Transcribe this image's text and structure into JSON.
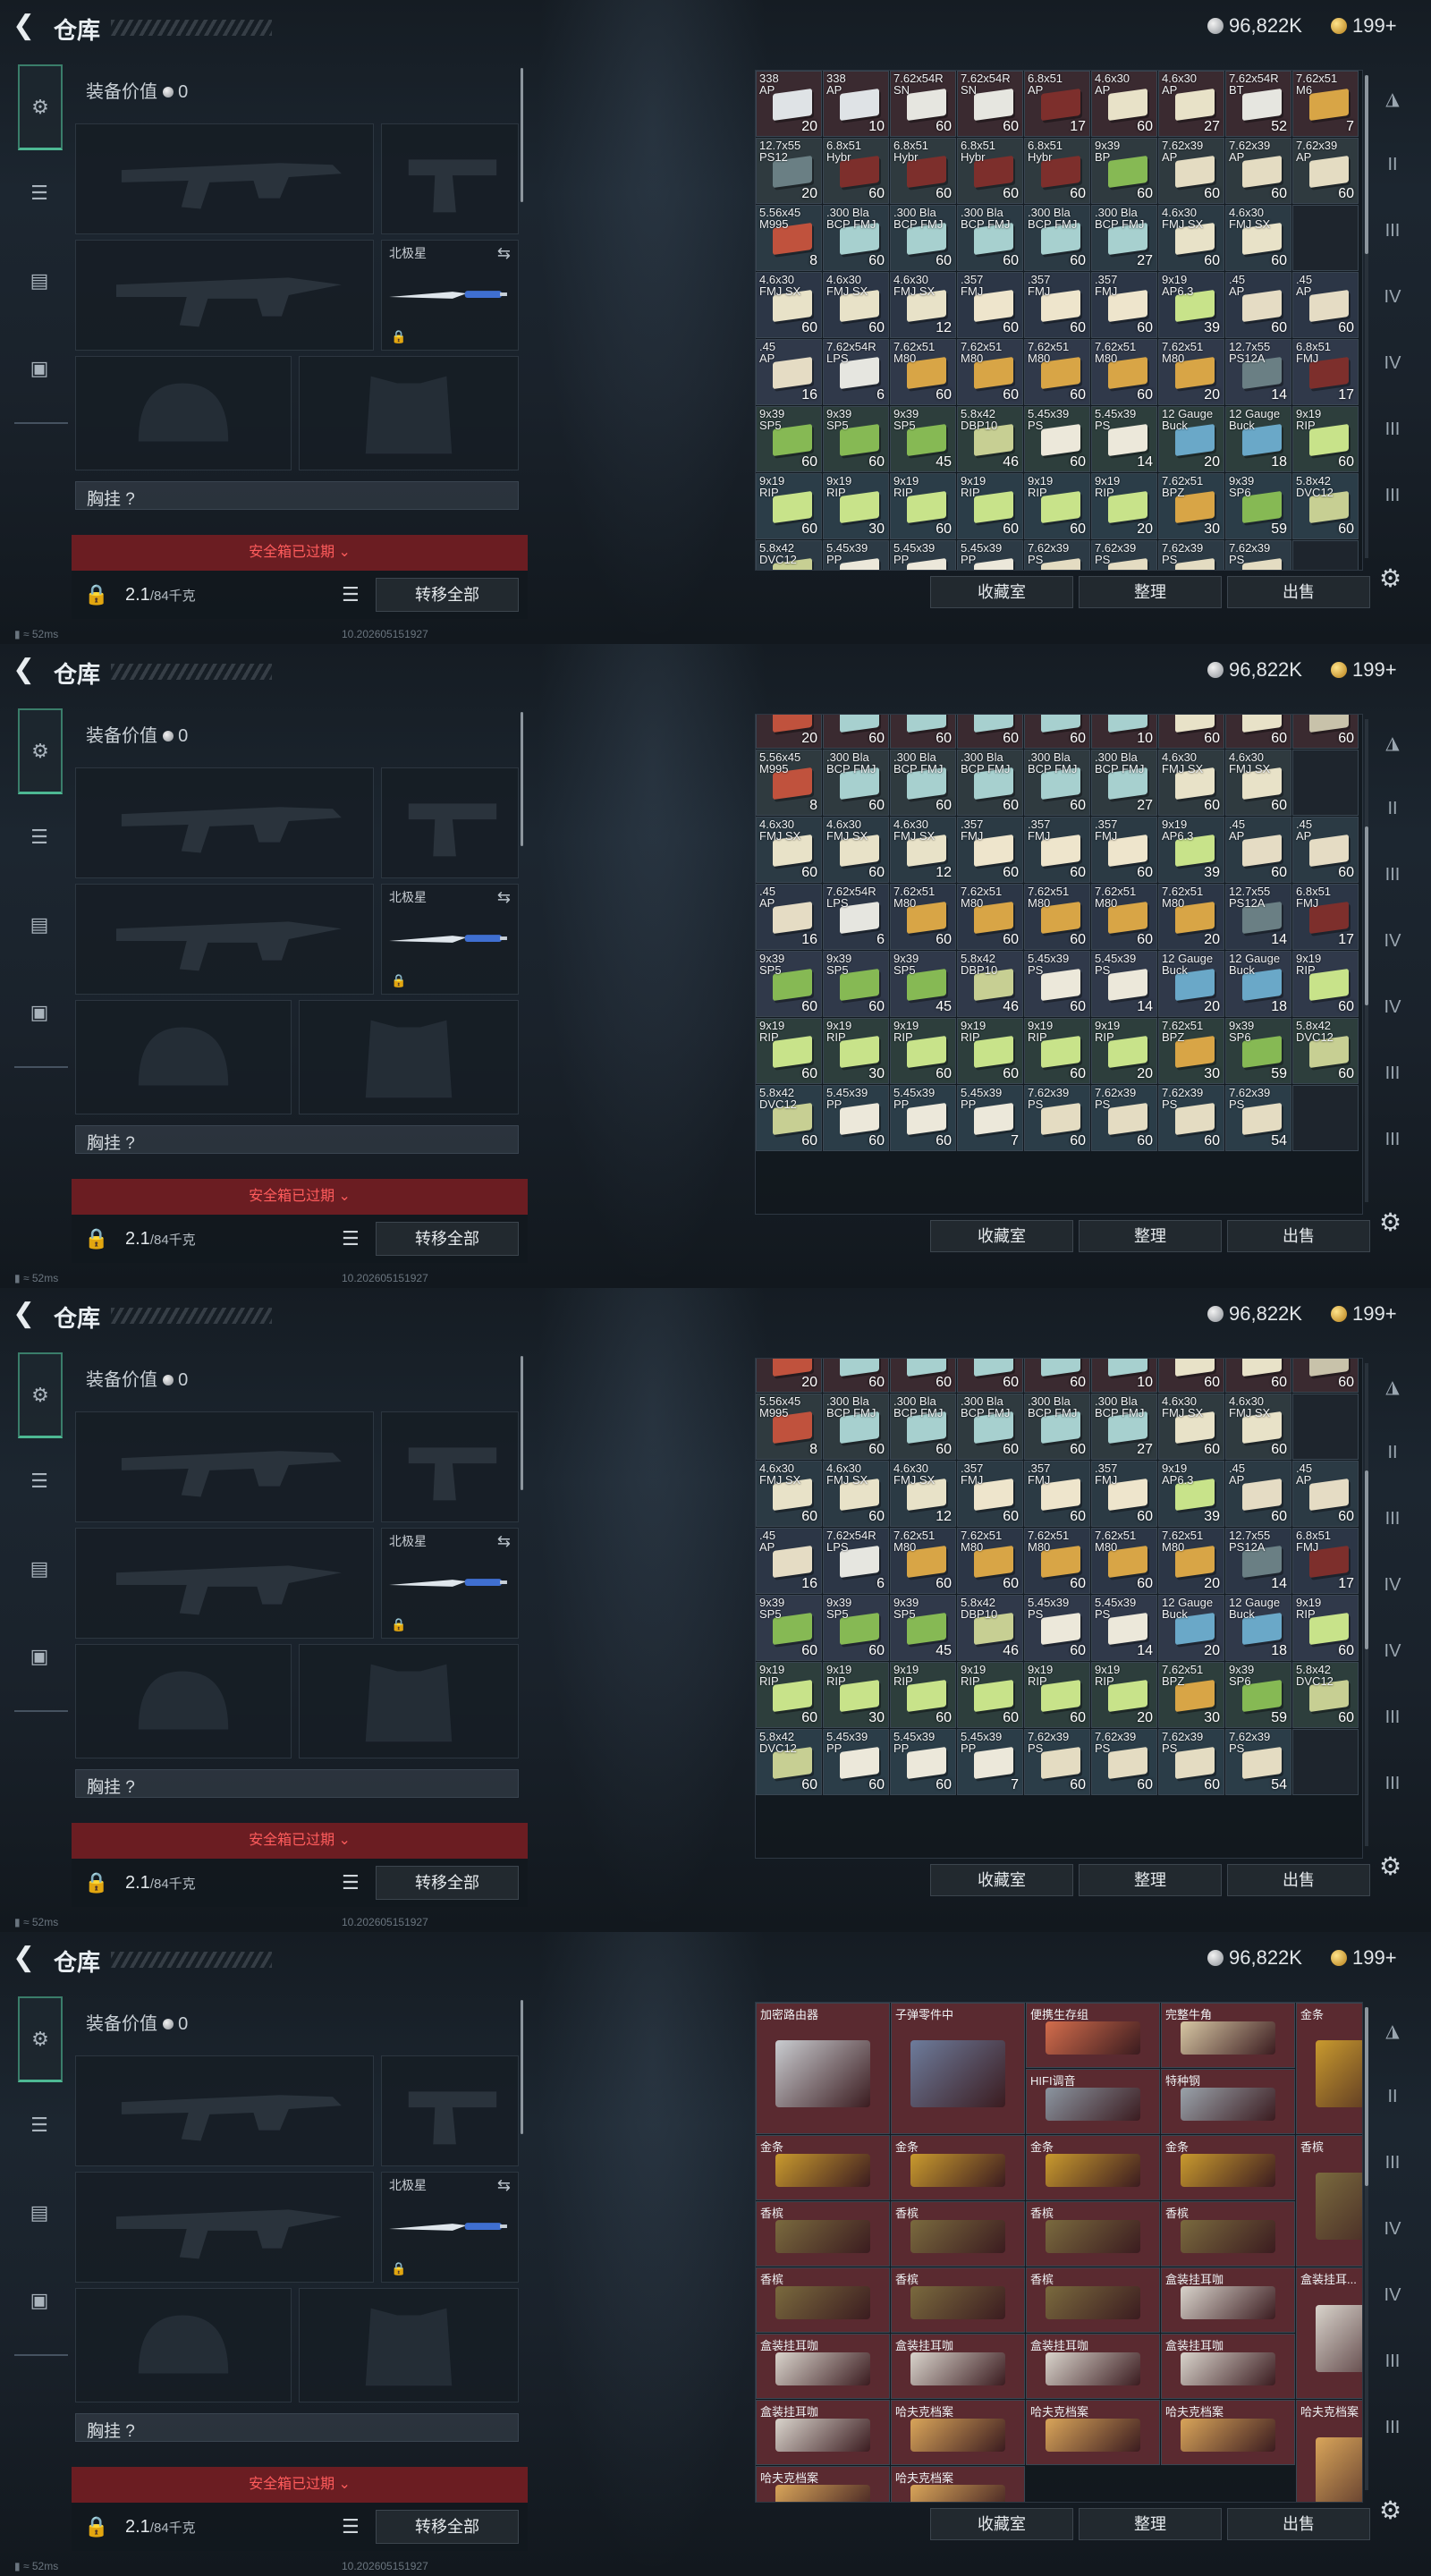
{
  "header": {
    "title": "仓库",
    "back_icon": "back-arrow-icon",
    "silver": "96,822K",
    "gold": "199+"
  },
  "left": {
    "equip_value_label": "装备价值",
    "equip_value": "0",
    "knife_name": "北极星",
    "vest_label": "胸挂",
    "vest_value": "?",
    "safe_box": "安全箱已过期",
    "weight": "2.1",
    "weight_cap": "/84千克",
    "transfer_all": "转移全部"
  },
  "right_buttons": {
    "collection": "收藏室",
    "sort": "整理",
    "sell": "出售"
  },
  "footer": {
    "ping": "52ms",
    "build": "10.2026051519​27"
  },
  "colors": {
    "accent": "#4db893",
    "danger": "#ff5c5c",
    "safe_bg": "#6b1d22"
  },
  "frames": [
    {
      "rows": [
        [
          [
            "338\nAP",
            "20"
          ],
          [
            "338\nAP",
            "10"
          ],
          [
            "7.62x54R\nSN",
            "60"
          ],
          [
            "7.62x54R\nSN",
            "60"
          ],
          [
            "6.8x51\nAP",
            "17"
          ],
          [
            "4.6x30\nAP",
            "60"
          ],
          [
            "4.6x30\nAP",
            "27"
          ],
          [
            "7.62x54R\nBT",
            "52"
          ],
          [
            "7.62x51\nM6",
            "7"
          ]
        ],
        [
          [
            "12.7x55\nPS12",
            "20"
          ],
          [
            "6.8x51\nHybr",
            "60"
          ],
          [
            "6.8x51\nHybr",
            "60"
          ],
          [
            "6.8x51\nHybr",
            "60"
          ],
          [
            "6.8x51\nHybr",
            "60"
          ],
          [
            "9x39\nBP",
            "60"
          ],
          [
            "7.62x39\nAP",
            "60"
          ],
          [
            "7.62x39\nAP",
            "60"
          ],
          [
            "7.62x39\nAP",
            "60"
          ]
        ],
        [
          [
            "5.56x45\nM995",
            "8"
          ],
          [
            ".300 Bla\nBCP FMJ",
            "60"
          ],
          [
            ".300 Bla\nBCP FMJ",
            "60"
          ],
          [
            ".300 Bla\nBCP FMJ",
            "60"
          ],
          [
            ".300 Bla\nBCP FMJ",
            "60"
          ],
          [
            ".300 Bla\nBCP FMJ",
            "27"
          ],
          [
            "4.6x30\nFMJ SX",
            "60"
          ],
          [
            "4.6x30\nFMJ SX",
            "60"
          ]
        ],
        [
          [
            "4.6x30\nFMJ SX",
            "60"
          ],
          [
            "4.6x30\nFMJ SX",
            "60"
          ],
          [
            "4.6x30\nFMJ SX",
            "12"
          ],
          [
            ".357\nFMJ",
            "60"
          ],
          [
            ".357\nFMJ",
            "60"
          ],
          [
            ".357\nFMJ",
            "60"
          ],
          [
            "9x19\nAP6.3",
            "39"
          ],
          [
            ".45\nAP",
            "60"
          ],
          [
            ".45\nAP",
            "60"
          ]
        ],
        [
          [
            ".45\nAP",
            "16"
          ],
          [
            "7.62x54R\nLPS",
            "6"
          ],
          [
            "7.62x51\nM80",
            "60"
          ],
          [
            "7.62x51\nM80",
            "60"
          ],
          [
            "7.62x51\nM80",
            "60"
          ],
          [
            "7.62x51\nM80",
            "60"
          ],
          [
            "7.62x51\nM80",
            "20"
          ],
          [
            "12.7x55\nPS12A",
            "14"
          ],
          [
            "6.8x51\nFMJ",
            "17"
          ]
        ],
        [
          [
            "9x39\nSP5",
            "60"
          ],
          [
            "9x39\nSP5",
            "60"
          ],
          [
            "9x39\nSP5",
            "45"
          ],
          [
            "5.8x42\nDBP10",
            "46"
          ],
          [
            "5.45x39\nPS",
            "60"
          ],
          [
            "5.45x39\nPS",
            "14"
          ],
          [
            "12 Gauge\nBuck",
            "20"
          ],
          [
            "12 Gauge\nBuck",
            "18"
          ],
          [
            "9x19\nRIP",
            "60"
          ]
        ],
        [
          [
            "9x19\nRIP",
            "60"
          ],
          [
            "9x19\nRIP",
            "30"
          ],
          [
            "9x19\nRIP",
            "60"
          ],
          [
            "9x19\nRIP",
            "60"
          ],
          [
            "9x19\nRIP",
            "60"
          ],
          [
            "9x19\nRIP",
            "20"
          ],
          [
            "7.62x51\nBPZ",
            "30"
          ],
          [
            "9x39\nSP6",
            "59"
          ],
          [
            "5.8x42\nDVC12",
            "60"
          ]
        ],
        [
          [
            "5.8x42\nDVC12",
            ""
          ],
          [
            "5.45x39\nPP",
            ""
          ],
          [
            "5.45x39\nPP",
            ""
          ],
          [
            "5.45x39\nPP",
            ""
          ],
          [
            "7.62x39\nPS",
            ""
          ],
          [
            "7.62x39\nPS",
            ""
          ],
          [
            "7.62x39\nPS",
            ""
          ],
          [
            "7.62x39\nPS",
            ""
          ]
        ]
      ]
    },
    {
      "rows": [
        [
          [
            "",
            "20"
          ],
          [
            "",
            "60"
          ],
          [
            "",
            "60"
          ],
          [
            "",
            "60"
          ],
          [
            "",
            "60"
          ],
          [
            "",
            "10"
          ],
          [
            "",
            "60"
          ],
          [
            "",
            "60"
          ],
          [
            "",
            "60"
          ]
        ],
        [
          [
            "5.56x45\nM995",
            "8"
          ],
          [
            ".300 Bla\nBCP FMJ",
            "60"
          ],
          [
            ".300 Bla\nBCP FMJ",
            "60"
          ],
          [
            ".300 Bla\nBCP FMJ",
            "60"
          ],
          [
            ".300 Bla\nBCP FMJ",
            "60"
          ],
          [
            ".300 Bla\nBCP FMJ",
            "27"
          ],
          [
            "4.6x30\nFMJ SX",
            "60"
          ],
          [
            "4.6x30\nFMJ SX",
            "60"
          ]
        ],
        [
          [
            "4.6x30\nFMJ SX",
            "60"
          ],
          [
            "4.6x30\nFMJ SX",
            "60"
          ],
          [
            "4.6x30\nFMJ SX",
            "12"
          ],
          [
            ".357\nFMJ",
            "60"
          ],
          [
            ".357\nFMJ",
            "60"
          ],
          [
            ".357\nFMJ",
            "60"
          ],
          [
            "9x19\nAP6.3",
            "39"
          ],
          [
            ".45\nAP",
            "60"
          ],
          [
            ".45\nAP",
            "60"
          ]
        ],
        [
          [
            ".45\nAP",
            "16"
          ],
          [
            "7.62x54R\nLPS",
            "6"
          ],
          [
            "7.62x51\nM80",
            "60"
          ],
          [
            "7.62x51\nM80",
            "60"
          ],
          [
            "7.62x51\nM80",
            "60"
          ],
          [
            "7.62x51\nM80",
            "60"
          ],
          [
            "7.62x51\nM80",
            "20"
          ],
          [
            "12.7x55\nPS12A",
            "14"
          ],
          [
            "6.8x51\nFMJ",
            "17"
          ]
        ],
        [
          [
            "9x39\nSP5",
            "60"
          ],
          [
            "9x39\nSP5",
            "60"
          ],
          [
            "9x39\nSP5",
            "45"
          ],
          [
            "5.8x42\nDBP10",
            "46"
          ],
          [
            "5.45x39\nPS",
            "60"
          ],
          [
            "5.45x39\nPS",
            "14"
          ],
          [
            "12 Gauge\nBuck",
            "20"
          ],
          [
            "12 Gauge\nBuck",
            "18"
          ],
          [
            "9x19\nRIP",
            "60"
          ]
        ],
        [
          [
            "9x19\nRIP",
            "60"
          ],
          [
            "9x19\nRIP",
            "30"
          ],
          [
            "9x19\nRIP",
            "60"
          ],
          [
            "9x19\nRIP",
            "60"
          ],
          [
            "9x19\nRIP",
            "60"
          ],
          [
            "9x19\nRIP",
            "20"
          ],
          [
            "7.62x51\nBPZ",
            "30"
          ],
          [
            "9x39\nSP6",
            "59"
          ],
          [
            "5.8x42\nDVC12",
            "60"
          ]
        ],
        [
          [
            "5.8x42\nDVC12",
            "60"
          ],
          [
            "5.45x39\nPP",
            "60"
          ],
          [
            "5.45x39\nPP",
            "60"
          ],
          [
            "5.45x39\nPP",
            "7"
          ],
          [
            "7.62x39\nPS",
            "60"
          ],
          [
            "7.62x39\nPS",
            "60"
          ],
          [
            "7.62x39\nPS",
            "60"
          ],
          [
            "7.62x39\nPS",
            "54"
          ]
        ]
      ]
    },
    {
      "rows": [
        [
          [
            "",
            "20"
          ],
          [
            "",
            "60"
          ],
          [
            "",
            "60"
          ],
          [
            "",
            "60"
          ],
          [
            "",
            "60"
          ],
          [
            "",
            "10"
          ],
          [
            "",
            "60"
          ],
          [
            "",
            "60"
          ],
          [
            "",
            "60"
          ]
        ],
        [
          [
            "5.56x45\nM995",
            "8"
          ],
          [
            ".300 Bla\nBCP FMJ",
            "60"
          ],
          [
            ".300 Bla\nBCP FMJ",
            "60"
          ],
          [
            ".300 Bla\nBCP FMJ",
            "60"
          ],
          [
            ".300 Bla\nBCP FMJ",
            "60"
          ],
          [
            ".300 Bla\nBCP FMJ",
            "27"
          ],
          [
            "4.6x30\nFMJ SX",
            "60"
          ],
          [
            "4.6x30\nFMJ SX",
            "60"
          ]
        ],
        [
          [
            "4.6x30\nFMJ SX",
            "60"
          ],
          [
            "4.6x30\nFMJ SX",
            "60"
          ],
          [
            "4.6x30\nFMJ SX",
            "12"
          ],
          [
            ".357\nFMJ",
            "60"
          ],
          [
            ".357\nFMJ",
            "60"
          ],
          [
            ".357\nFMJ",
            "60"
          ],
          [
            "9x19\nAP6.3",
            "39"
          ],
          [
            ".45\nAP",
            "60"
          ],
          [
            ".45\nAP",
            "60"
          ]
        ],
        [
          [
            ".45\nAP",
            "16"
          ],
          [
            "7.62x54R\nLPS",
            "6"
          ],
          [
            "7.62x51\nM80",
            "60"
          ],
          [
            "7.62x51\nM80",
            "60"
          ],
          [
            "7.62x51\nM80",
            "60"
          ],
          [
            "7.62x51\nM80",
            "60"
          ],
          [
            "7.62x51\nM80",
            "20"
          ],
          [
            "12.7x55\nPS12A",
            "14"
          ],
          [
            "6.8x51\nFMJ",
            "17"
          ]
        ],
        [
          [
            "9x39\nSP5",
            "60"
          ],
          [
            "9x39\nSP5",
            "60"
          ],
          [
            "9x39\nSP5",
            "45"
          ],
          [
            "5.8x42\nDBP10",
            "46"
          ],
          [
            "5.45x39\nPS",
            "60"
          ],
          [
            "5.45x39\nPS",
            "14"
          ],
          [
            "12 Gauge\nBuck",
            "20"
          ],
          [
            "12 Gauge\nBuck",
            "18"
          ],
          [
            "9x19\nRIP",
            "60"
          ]
        ],
        [
          [
            "9x19\nRIP",
            "60"
          ],
          [
            "9x19\nRIP",
            "30"
          ],
          [
            "9x19\nRIP",
            "60"
          ],
          [
            "9x19\nRIP",
            "60"
          ],
          [
            "9x19\nRIP",
            "60"
          ],
          [
            "9x19\nRIP",
            "20"
          ],
          [
            "7.62x51\nBPZ",
            "30"
          ],
          [
            "9x39\nSP6",
            "59"
          ],
          [
            "5.8x42\nDVC12",
            "60"
          ]
        ],
        [
          [
            "5.8x42\nDVC12",
            "60"
          ],
          [
            "5.45x39\nPP",
            "60"
          ],
          [
            "5.45x39\nPP",
            "60"
          ],
          [
            "5.45x39\nPP",
            "7"
          ],
          [
            "7.62x39\nPS",
            "60"
          ],
          [
            "7.62x39\nPS",
            "60"
          ],
          [
            "7.62x39\nPS",
            "60"
          ],
          [
            "7.62x39\nPS",
            "54"
          ]
        ]
      ]
    }
  ],
  "valuables": [
    {
      "name": "加密路由器",
      "c": 0,
      "r": 0,
      "w": 1,
      "h": 2,
      "color": "#c9ccd0"
    },
    {
      "name": "子弹零件中",
      "c": 1,
      "r": 0,
      "w": 1,
      "h": 2,
      "color": "#6d7c9c"
    },
    {
      "name": "便携生存组",
      "c": 2,
      "r": 0,
      "w": 1,
      "h": 1,
      "color": "#d36d4c"
    },
    {
      "name": "完整牛角",
      "c": 3,
      "r": 0,
      "w": 1,
      "h": 1,
      "color": "#d7c7a4"
    },
    {
      "name": "金条",
      "c": 4,
      "r": 0,
      "w": 1,
      "h": 2,
      "color": "#c99a2e"
    },
    {
      "name": "HIFI调音",
      "c": 2,
      "r": 1,
      "w": 1,
      "h": 1,
      "color": "#8b95a0"
    },
    {
      "name": "特种钢",
      "c": 3,
      "r": 1,
      "w": 1,
      "h": 1,
      "color": "#9aa3ab"
    },
    {
      "name": "金条",
      "c": 0,
      "r": 2,
      "w": 1,
      "h": 1,
      "color": "#c99a2e"
    },
    {
      "name": "金条",
      "c": 1,
      "r": 2,
      "w": 1,
      "h": 1,
      "color": "#c99a2e"
    },
    {
      "name": "金条",
      "c": 2,
      "r": 2,
      "w": 1,
      "h": 1,
      "color": "#c99a2e"
    },
    {
      "name": "金条",
      "c": 3,
      "r": 2,
      "w": 1,
      "h": 1,
      "color": "#c99a2e"
    },
    {
      "name": "香槟",
      "c": 4,
      "r": 2,
      "w": 1,
      "h": 2,
      "color": "#7a6a3e"
    },
    {
      "name": "香槟",
      "c": 0,
      "r": 3,
      "w": 1,
      "h": 1,
      "color": "#7a6a3e"
    },
    {
      "name": "香槟",
      "c": 1,
      "r": 3,
      "w": 1,
      "h": 1,
      "color": "#7a6a3e"
    },
    {
      "name": "香槟",
      "c": 2,
      "r": 3,
      "w": 1,
      "h": 1,
      "color": "#7a6a3e"
    },
    {
      "name": "香槟",
      "c": 3,
      "r": 3,
      "w": 1,
      "h": 1,
      "color": "#7a6a3e"
    },
    {
      "name": "香槟",
      "c": 0,
      "r": 4,
      "w": 1,
      "h": 1,
      "color": "#7a6a3e"
    },
    {
      "name": "香槟",
      "c": 1,
      "r": 4,
      "w": 1,
      "h": 1,
      "color": "#7a6a3e"
    },
    {
      "name": "香槟",
      "c": 2,
      "r": 4,
      "w": 1,
      "h": 1,
      "color": "#7a6a3e"
    },
    {
      "name": "盒装挂耳咖",
      "c": 3,
      "r": 4,
      "w": 1,
      "h": 1,
      "color": "#d9d4cc"
    },
    {
      "name": "盒装挂耳...",
      "c": 4,
      "r": 4,
      "w": 1,
      "h": 2,
      "color": "#d9d4cc"
    },
    {
      "name": "盒装挂耳咖",
      "c": 0,
      "r": 5,
      "w": 1,
      "h": 1,
      "color": "#d9d4cc"
    },
    {
      "name": "盒装挂耳咖",
      "c": 1,
      "r": 5,
      "w": 1,
      "h": 1,
      "color": "#d9d4cc"
    },
    {
      "name": "盒装挂耳咖",
      "c": 2,
      "r": 5,
      "w": 1,
      "h": 1,
      "color": "#d9d4cc"
    },
    {
      "name": "盒装挂耳咖",
      "c": 3,
      "r": 5,
      "w": 1,
      "h": 1,
      "color": "#d9d4cc"
    },
    {
      "name": "盒装挂耳咖",
      "c": 0,
      "r": 6,
      "w": 1,
      "h": 1,
      "color": "#d9d4cc"
    },
    {
      "name": "哈夫克档案",
      "c": 1,
      "r": 6,
      "w": 1,
      "h": 1,
      "color": "#d9a55a"
    },
    {
      "name": "哈夫克档案",
      "c": 2,
      "r": 6,
      "w": 1,
      "h": 1,
      "color": "#d9a55a"
    },
    {
      "name": "哈夫克档案",
      "c": 3,
      "r": 6,
      "w": 1,
      "h": 1,
      "color": "#d9a55a"
    },
    {
      "name": "哈夫克档案",
      "c": 4,
      "r": 6,
      "w": 1,
      "h": 2,
      "color": "#d9a55a"
    },
    {
      "name": "哈夫克档案",
      "c": 0,
      "r": 7,
      "w": 1,
      "h": 1,
      "color": "#d9a55a"
    },
    {
      "name": "哈夫克档案",
      "c": 1,
      "r": 7,
      "w": 1,
      "h": 1,
      "color": "#d9a55a"
    }
  ]
}
